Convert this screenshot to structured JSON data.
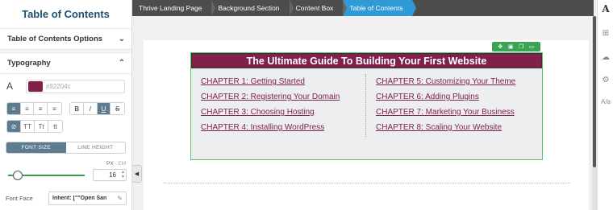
{
  "left_panel": {
    "title": "Table of Contents",
    "sections": {
      "options_label": "Table of Contents Options",
      "typography_label": "Typography"
    },
    "color": {
      "icon": "A",
      "hex": "#82204c",
      "placeholder": "#82204c"
    },
    "format_buttons": {
      "align": [
        "align-left-icon",
        "align-center-icon",
        "align-right-icon",
        "align-justify-icon"
      ],
      "style": [
        "B",
        "I",
        "U",
        "S"
      ],
      "case": [
        "⊘",
        "TT",
        "Tt",
        "tt"
      ]
    },
    "tabs": [
      "FONT SIZE",
      "LINE HEIGHT"
    ],
    "units": {
      "px": "PX",
      "sep": "-",
      "em": "EM"
    },
    "font_size_value": "16",
    "font_size_level": 16,
    "font_face_label": "Font Face",
    "font_face_value": "Inherit: [\"\"Open San"
  },
  "breadcrumb": [
    "Thrive Landing Page",
    "Background Section",
    "Content Box",
    "Table of Contents"
  ],
  "toc": {
    "title": "The Ultimate Guide To Building Your First Website",
    "left_links": [
      "CHAPTER 1: Getting Started",
      "CHAPTER 2: Registering Your Domain",
      "CHAPTER 3: Choosing Hosting",
      "CHAPTER 4: Installing WordPress"
    ],
    "right_links": [
      "CHAPTER 5: Customizing Your Theme",
      "CHAPTER 6: Adding Plugins",
      "CHAPTER 7: Marketing Your Business",
      "CHAPTER 8: Scaling Your Website"
    ],
    "accent_color": "#82204c",
    "selection_color": "#5cc36f"
  },
  "toolbar_icons": [
    "move-icon",
    "save-icon",
    "duplicate-icon",
    "delete-icon"
  ],
  "rail_icons": [
    "thrive-logo-icon",
    "add-element-icon",
    "cloud-icon",
    "settings-gear-icon",
    "translate-icon"
  ],
  "rail_logo_text": "A"
}
